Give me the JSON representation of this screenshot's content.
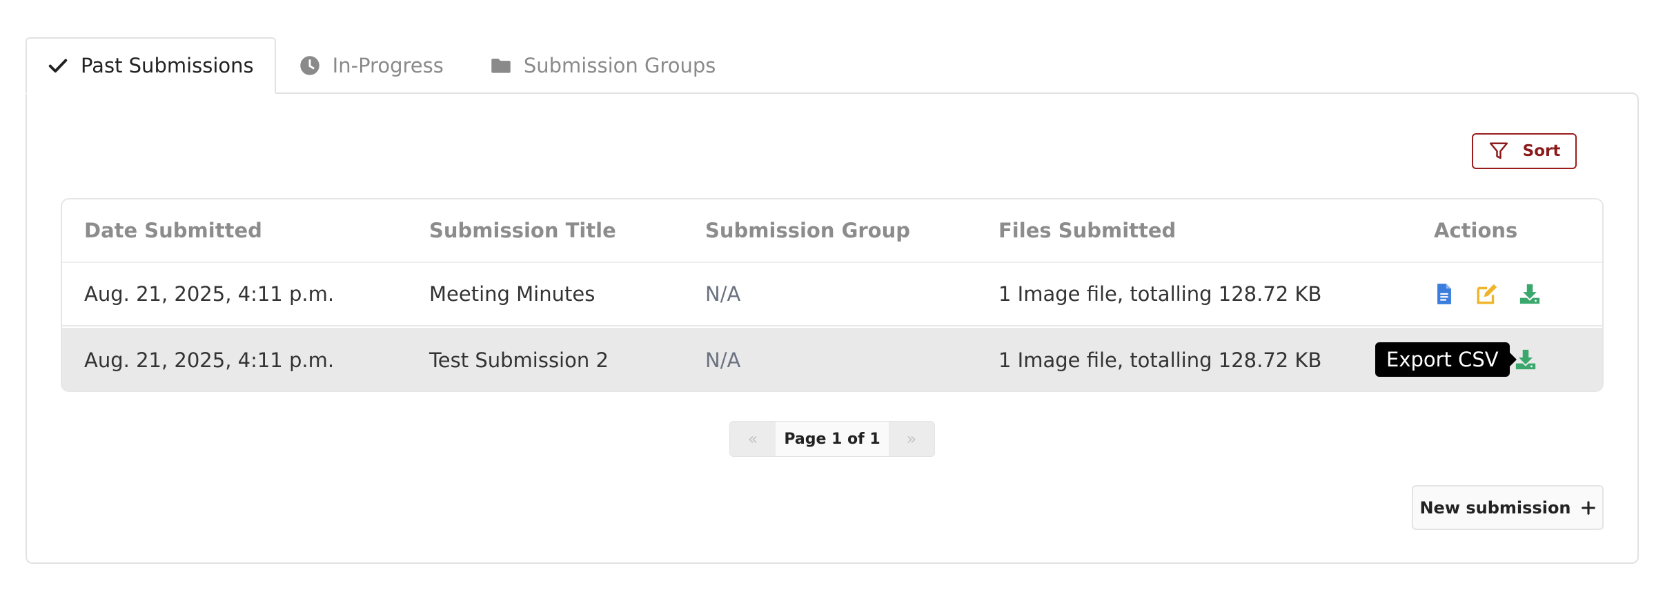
{
  "tabs": [
    {
      "label": "Past Submissions",
      "icon": "check-icon",
      "active": true
    },
    {
      "label": "In-Progress",
      "icon": "clock-icon",
      "active": false
    },
    {
      "label": "Submission Groups",
      "icon": "folder-icon",
      "active": false
    }
  ],
  "toolbar": {
    "sort_label": "Sort"
  },
  "table": {
    "headers": [
      "Date Submitted",
      "Submission Title",
      "Submission Group",
      "Files Submitted",
      "Actions"
    ],
    "rows": [
      {
        "date": "Aug. 21, 2025, 4:11 p.m.",
        "title": "Meeting Minutes",
        "group": "N/A",
        "files": "1 Image file, totalling 128.72 KB"
      },
      {
        "date": "Aug. 21, 2025, 4:11 p.m.",
        "title": "Test Submission 2",
        "group": "N/A",
        "files": "1 Image file, totalling 128.72 KB"
      }
    ]
  },
  "tooltip": {
    "text": "Export CSV"
  },
  "pagination": {
    "prev": "«",
    "label": "Page 1 of 1",
    "next": "»"
  },
  "new_submission": {
    "label": "New submission"
  },
  "colors": {
    "sort_border": "#9b1c1c",
    "view_icon": "#3b7ddd",
    "edit_icon": "#f0b429",
    "download_icon": "#3aa76d",
    "hover_row": "#e9e9e9"
  }
}
